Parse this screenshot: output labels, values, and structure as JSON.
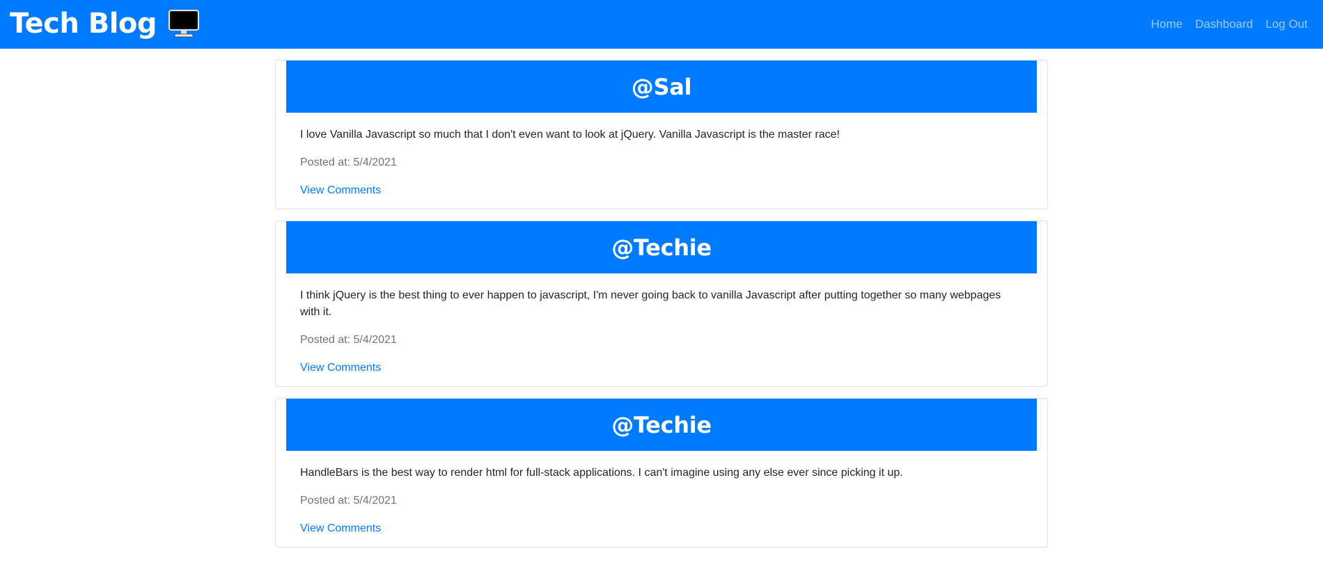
{
  "header": {
    "title": "Tech Blog",
    "icon": "computer-monitor-icon",
    "nav": {
      "home": "Home",
      "dashboard": "Dashboard",
      "logout": "Log Out"
    }
  },
  "colors": {
    "primary": "#007bff",
    "nav_link": "rgba(255,255,255,0.6)",
    "muted": "#6c757d",
    "border": "#dee2e6"
  },
  "posts": [
    {
      "author": "@Sal",
      "content": "I love Vanilla Javascript so much that I don't even want to look at jQuery. Vanilla Javascript is the master race!",
      "posted_label": "Posted at:",
      "posted_date": "5/4/2021",
      "comments_link": "View Comments"
    },
    {
      "author": "@Techie",
      "content": "I think jQuery is the best thing to ever happen to javascript, I'm never going back to vanilla Javascript after putting together so many webpages with it.",
      "posted_label": "Posted at:",
      "posted_date": "5/4/2021",
      "comments_link": "View Comments"
    },
    {
      "author": "@Techie",
      "content": "HandleBars is the best way to render html for full-stack applications. I can't imagine using any else ever since picking it up.",
      "posted_label": "Posted at:",
      "posted_date": "5/4/2021",
      "comments_link": "View Comments"
    }
  ]
}
